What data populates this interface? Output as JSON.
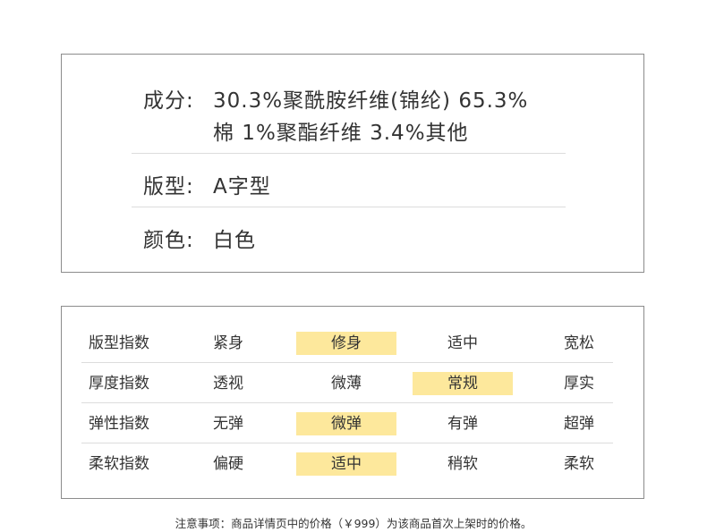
{
  "attributes": {
    "composition": {
      "label": "成分:",
      "line1": "30.3%聚酰胺纤维(锦纶) 65.3%",
      "line2": "棉 1%聚酯纤维 3.4%其他"
    },
    "fit": {
      "label": "版型:",
      "value": "A字型"
    },
    "color": {
      "label": "颜色:",
      "value": "白色"
    }
  },
  "indices": {
    "rows": [
      {
        "label": "版型指数",
        "options": [
          "紧身",
          "修身",
          "适中",
          "宽松"
        ],
        "selected_index": 1
      },
      {
        "label": "厚度指数",
        "options": [
          "透视",
          "微薄",
          "常规",
          "厚实"
        ],
        "selected_index": 2
      },
      {
        "label": "弹性指数",
        "options": [
          "无弹",
          "微弹",
          "有弹",
          "超弹"
        ],
        "selected_index": 1
      },
      {
        "label": "柔软指数",
        "options": [
          "偏硬",
          "适中",
          "稍软",
          "柔软"
        ],
        "selected_index": 1
      }
    ],
    "highlight_color": "#fde89c"
  },
  "note": "注意事项：商品详情页中的价格（￥999）为该商品首次上架时的价格。"
}
